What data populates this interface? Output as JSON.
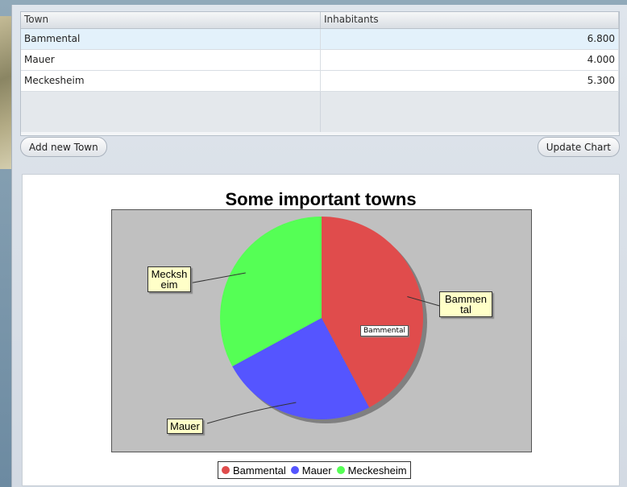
{
  "table": {
    "headers": [
      "Town",
      "Inhabitants"
    ],
    "rows": [
      {
        "town": "Bammental",
        "inhabitants": "6.800"
      },
      {
        "town": "Mauer",
        "inhabitants": "4.000"
      },
      {
        "town": "Meckesheim",
        "inhabitants": "5.300"
      }
    ]
  },
  "buttons": {
    "add_label": "Add new Town",
    "update_label": "Update Chart"
  },
  "chart": {
    "tooltip": "Bammental",
    "slice_labels": {
      "bammental": "Bammen\ntal",
      "mauer": "Mauer",
      "meckesheim": "Mecksh\neim"
    }
  },
  "chart_data": {
    "type": "pie",
    "title": "Some important towns",
    "categories": [
      "Bammental",
      "Mauer",
      "Meckesheim"
    ],
    "values": [
      6800,
      4000,
      5300
    ],
    "colors": [
      "#e04c4c",
      "#5555ff",
      "#55ff55"
    ],
    "legend": "bottom"
  }
}
